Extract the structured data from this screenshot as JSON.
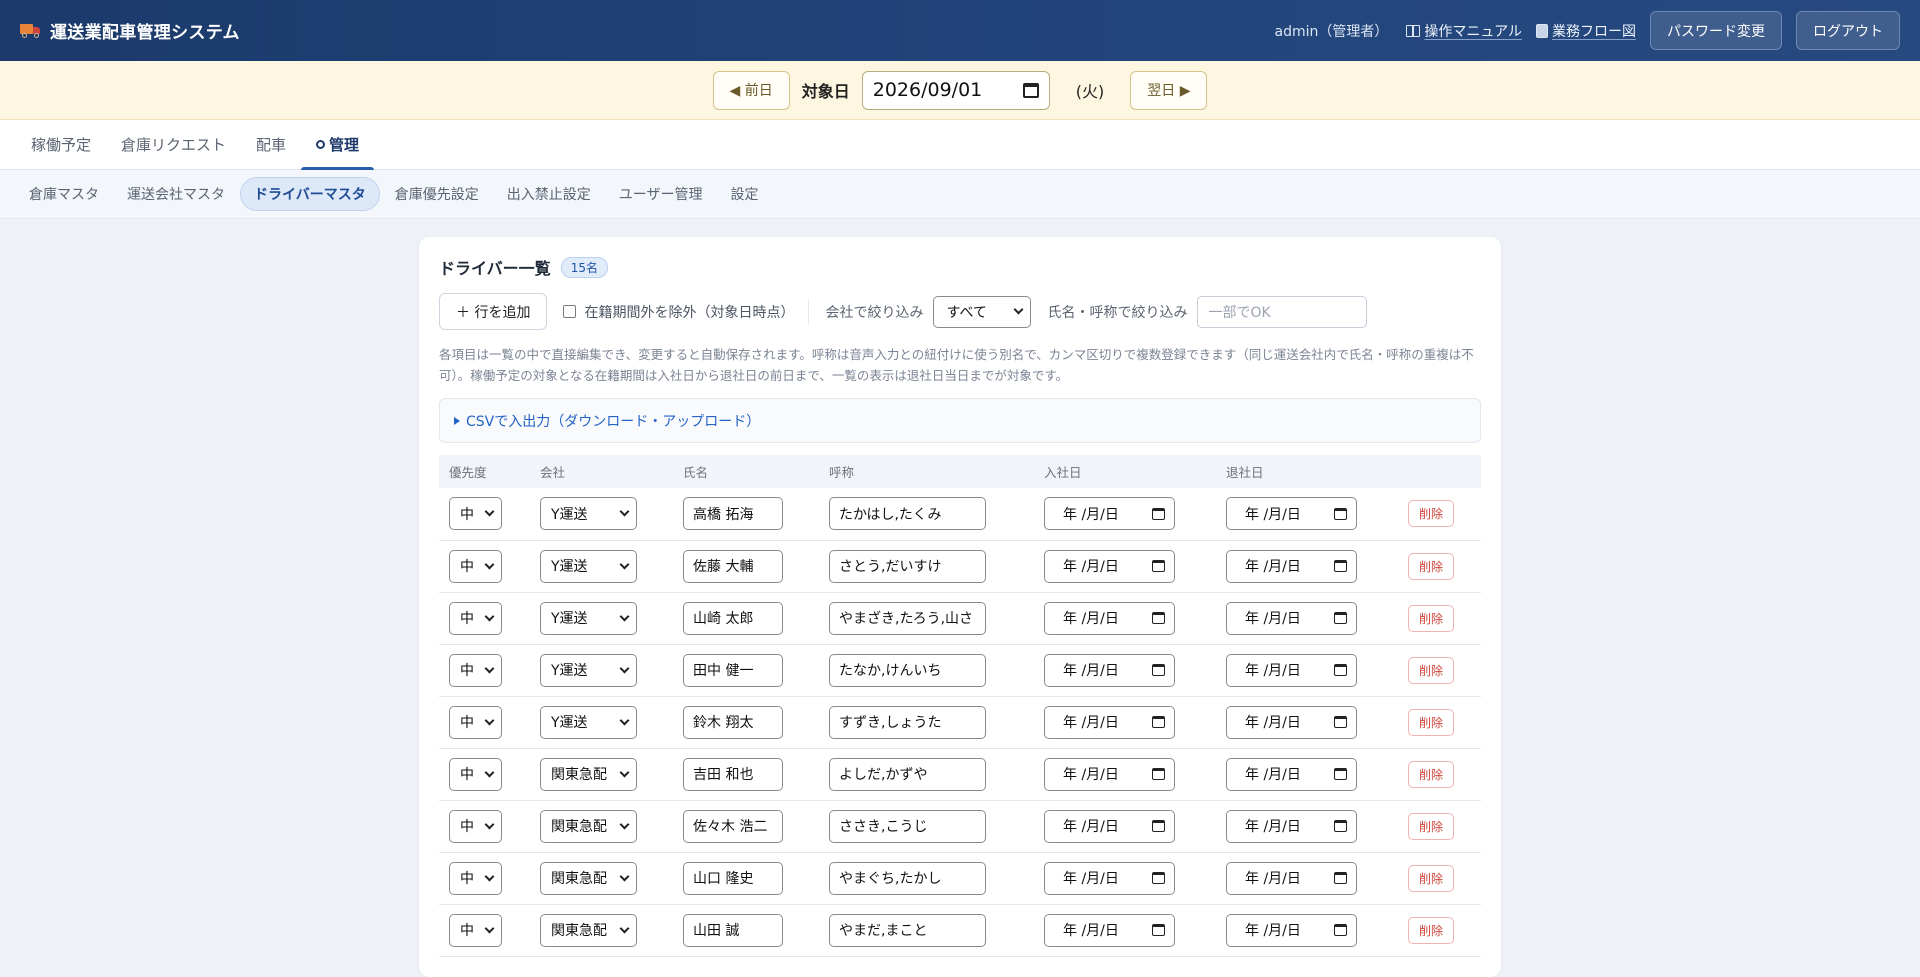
{
  "header": {
    "app_title": "運送業配車管理システム",
    "user": "admin（管理者）",
    "manual_link": "操作マニュアル",
    "flow_link": "業務フロー図",
    "password_button": "パスワード変更",
    "logout_button": "ログアウト"
  },
  "datebar": {
    "prev_button": "◀ 前日",
    "label": "対象日",
    "date_value": "2026/09/01",
    "weekday": "(火)",
    "next_button": "翌日 ▶"
  },
  "main_tabs": [
    {
      "label": "稼働予定",
      "active": false
    },
    {
      "label": "倉庫リクエスト",
      "active": false
    },
    {
      "label": "配車",
      "active": false
    },
    {
      "label": "管理",
      "active": true
    }
  ],
  "sub_tabs": [
    {
      "label": "倉庫マスタ",
      "active": false
    },
    {
      "label": "運送会社マスタ",
      "active": false
    },
    {
      "label": "ドライバーマスタ",
      "active": true
    },
    {
      "label": "倉庫優先設定",
      "active": false
    },
    {
      "label": "出入禁止設定",
      "active": false
    },
    {
      "label": "ユーザー管理",
      "active": false
    },
    {
      "label": "設定",
      "active": false
    }
  ],
  "card": {
    "title": "ドライバー一覧",
    "count": "15名",
    "add_row_button": "＋ 行を追加",
    "exclude_checkbox_label": "在籍期間外を除外（対象日時点）",
    "company_filter_label": "会社で絞り込み",
    "company_filter_value": "すべて",
    "name_filter_label": "氏名・呼称で絞り込み",
    "name_filter_placeholder": "一部でOK",
    "notice": "各項目は一覧の中で直接編集でき、変更すると自動保存されます。呼称は音声入力との紐付けに使う別名で、カンマ区切りで複数登録できます（同じ運送会社内で氏名・呼称の重複は不可）。稼働予定の対象となる在籍期間は入社日から退社日の前日まで、一覧の表示は退社日当日までが対象です。",
    "csv_label": "CSVで入出力（ダウンロード・アップロード）"
  },
  "table": {
    "headers": [
      "優先度",
      "会社",
      "氏名",
      "呼称",
      "入社日",
      "退社日",
      ""
    ],
    "date_placeholder": "年 /月/日",
    "delete_label": "削除",
    "rows": [
      {
        "priority": "中",
        "company": "Y運送",
        "name": "高橋 拓海",
        "alias": "たかはし,たくみ"
      },
      {
        "priority": "中",
        "company": "Y運送",
        "name": "佐藤 大輔",
        "alias": "さとう,だいすけ"
      },
      {
        "priority": "中",
        "company": "Y運送",
        "name": "山崎 太郎",
        "alias": "やまざき,たろう,山さ"
      },
      {
        "priority": "中",
        "company": "Y運送",
        "name": "田中 健一",
        "alias": "たなか,けんいち"
      },
      {
        "priority": "中",
        "company": "Y運送",
        "name": "鈴木 翔太",
        "alias": "すずき,しょうた"
      },
      {
        "priority": "中",
        "company": "関東急配",
        "name": "吉田 和也",
        "alias": "よしだ,かずや"
      },
      {
        "priority": "中",
        "company": "関東急配",
        "name": "佐々木 浩二",
        "alias": "ささき,こうじ"
      },
      {
        "priority": "中",
        "company": "関東急配",
        "name": "山口 隆史",
        "alias": "やまぐち,たかし"
      },
      {
        "priority": "中",
        "company": "関東急配",
        "name": "山田 誠",
        "alias": "やまだ,まこと"
      }
    ]
  }
}
